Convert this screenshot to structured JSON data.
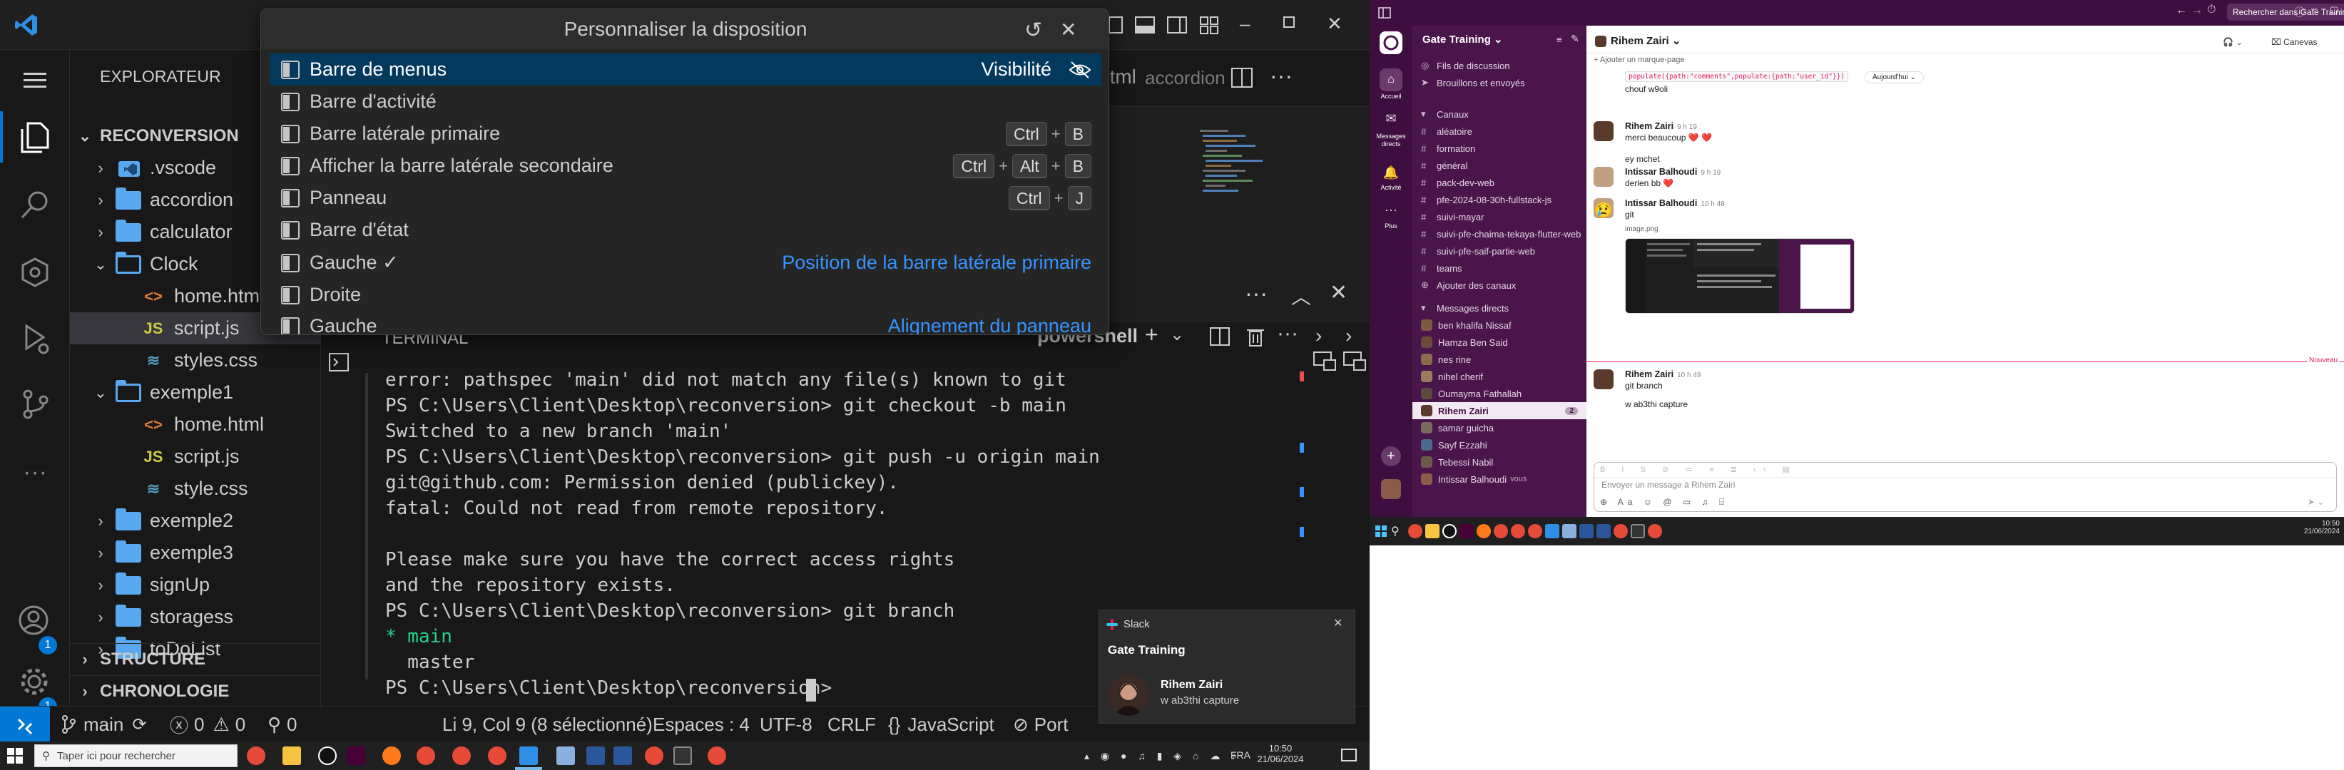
{
  "vscode": {
    "explorer_title": "EXPLORATEUR",
    "root": "RECONVERSION",
    "tree": [
      {
        "label": ".vscode",
        "kind": "vscode-folder",
        "depth": 1,
        "twisty": "›"
      },
      {
        "label": "accordion",
        "kind": "folder",
        "depth": 1,
        "twisty": "›"
      },
      {
        "label": "calculator",
        "kind": "folder",
        "depth": 1,
        "twisty": "›"
      },
      {
        "label": "Clock",
        "kind": "folder-open",
        "depth": 1,
        "twisty": "⌄"
      },
      {
        "label": "home.html",
        "kind": "html",
        "depth": 2,
        "twisty": ""
      },
      {
        "label": "script.js",
        "kind": "js",
        "depth": 2,
        "twisty": "",
        "selected": true
      },
      {
        "label": "styles.css",
        "kind": "css",
        "depth": 2,
        "twisty": ""
      },
      {
        "label": "exemple1",
        "kind": "folder-open",
        "depth": 1,
        "twisty": "⌄"
      },
      {
        "label": "home.html",
        "kind": "html",
        "depth": 2,
        "twisty": ""
      },
      {
        "label": "script.js",
        "kind": "js",
        "depth": 2,
        "twisty": ""
      },
      {
        "label": "style.css",
        "kind": "css",
        "depth": 2,
        "twisty": ""
      },
      {
        "label": "exemple2",
        "kind": "folder",
        "depth": 1,
        "twisty": "›"
      },
      {
        "label": "exemple3",
        "kind": "folder",
        "depth": 1,
        "twisty": "›"
      },
      {
        "label": "signUp",
        "kind": "folder",
        "depth": 1,
        "twisty": "›"
      },
      {
        "label": "storagess",
        "kind": "folder",
        "depth": 1,
        "twisty": "›"
      },
      {
        "label": "toDoList",
        "kind": "folder",
        "depth": 1,
        "twisty": "›"
      }
    ],
    "sections": [
      "STRUCTURE",
      "CHRONOLOGIE"
    ],
    "tab_peek": "html",
    "tab_peek2": "accordion",
    "quickpick": {
      "title": "Personnaliser la disposition",
      "rows": [
        {
          "label": "Barre de menus",
          "right": "Visibilité",
          "keys": []
        },
        {
          "label": "Barre d'activité",
          "keys": []
        },
        {
          "label": "Barre latérale primaire",
          "keys": [
            "Ctrl",
            "B"
          ]
        },
        {
          "label": "Afficher la barre latérale secondaire",
          "keys": [
            "Ctrl",
            "Alt",
            "B"
          ]
        },
        {
          "label": "Panneau",
          "keys": [
            "Ctrl",
            "J"
          ]
        },
        {
          "label": "Barre d'état",
          "keys": []
        },
        {
          "label": "Gauche ✓",
          "right": "Position de la barre latérale primaire",
          "keys": []
        },
        {
          "label": "Droite",
          "keys": []
        },
        {
          "label": "Gauche",
          "right": "Alignement du panneau",
          "keys": []
        }
      ]
    },
    "panel_tab": "TERMINAL",
    "shell": "powershell",
    "terminal": [
      {
        "t": "error: pathspec 'main' did not match any file(s) known to git"
      },
      {
        "t": "PS C:\\Users\\Client\\Desktop\\reconversion> git checkout -b main"
      },
      {
        "t": "Switched to a new branch 'main'"
      },
      {
        "t": "PS C:\\Users\\Client\\Desktop\\reconversion> git push -u origin main"
      },
      {
        "t": "git@github.com: Permission denied (publickey)."
      },
      {
        "t": "fatal: Could not read from remote repository."
      },
      {
        "t": ""
      },
      {
        "t": "Please make sure you have the correct access rights"
      },
      {
        "t": "and the repository exists."
      },
      {
        "t": "PS C:\\Users\\Client\\Desktop\\reconversion> git branch"
      },
      {
        "t": "* main",
        "green": true
      },
      {
        "t": "  master"
      },
      {
        "t": "PS C:\\Users\\Client\\Desktop\\reconversion> "
      }
    ],
    "status": {
      "branch": "main",
      "errors": "0",
      "warnings": "0",
      "ports": "0",
      "position": "Li 9, Col 9 (8 sélectionné)",
      "spaces": "Espaces : 4",
      "encoding": "UTF-8",
      "eol": "CRLF",
      "language": "JavaScript",
      "port_label": "Port"
    },
    "badge": "1",
    "notification": {
      "app": "Slack",
      "workspace": "Gate Training",
      "sender": "Rihem Zairi",
      "text": "w ab3thi capture"
    }
  },
  "taskbar_left": {
    "search_placeholder": "Taper ici pour rechercher",
    "lang": "FRA",
    "time": "10:50",
    "date": "21/06/2024"
  },
  "slack": {
    "search": "Rechercher dans Gate Training",
    "workspace": "Gate Training",
    "rail": [
      {
        "label": "Accueil"
      },
      {
        "label": "Messages directs"
      },
      {
        "label": "Activité"
      },
      {
        "label": "Plus"
      }
    ],
    "top_items": [
      "Fils de discussion",
      "Brouillons et envoyés"
    ],
    "channels_header": "Canaux",
    "channels": [
      "aléatoire",
      "formation",
      "général",
      "pack-dev-web",
      "pfe-2024-08-30h-fullstack-js",
      "suivi-mayar",
      "suivi-pfe-chaima-tekaya-flutter-web",
      "suivi-pfe-saif-partie-web",
      "teams"
    ],
    "add_channels": "Ajouter des canaux",
    "dm_header": "Messages directs",
    "dms": [
      {
        "name": "ben khalifa Nissaf"
      },
      {
        "name": "Hamza Ben Said"
      },
      {
        "name": "nes rine"
      },
      {
        "name": "nihel cherif"
      },
      {
        "name": "Oumayma Fathallah"
      },
      {
        "name": "Rihem Zairi",
        "active": true,
        "count": "2"
      },
      {
        "name": "samar guicha"
      },
      {
        "name": "Sayf Ezzahi"
      },
      {
        "name": "Tebessi Nabil"
      },
      {
        "name": "Intissar Balhoudi",
        "suffix": "vous"
      }
    ],
    "channel_name": "Rihem Zairi",
    "canvas": "Canevas",
    "bookmark": "Ajouter un marque-page",
    "code_snippet": "populate({path:\"comments\",populate:{path:\"user_id\"}})",
    "date_pill": "Aujourd'hui",
    "first_line": "chouf w9oli",
    "messages": [
      {
        "name": "Rihem Zairi",
        "time": "9 h 19",
        "lines": [
          "merci beaucoup ❤️ ❤️",
          "ey mchet"
        ]
      },
      {
        "name": "Intissar Balhoudi",
        "time": "9 h 19",
        "lines": [
          "derlen bb ❤️"
        ]
      },
      {
        "name": "Intissar Balhoudi",
        "time": "10 h 48",
        "lines": [
          "git"
        ],
        "image_label": "image.png"
      }
    ],
    "emoji_line": "😢",
    "new_label": "Nouveau",
    "last_msg": {
      "name": "Rihem Zairi",
      "time": "10 h 49",
      "lines": [
        "git branch",
        "w ab3thi capture"
      ]
    },
    "composer_placeholder": "Envoyer un message à Rihem Zairi",
    "composer_aa": "Aa"
  },
  "taskbar_right": {
    "time": "10:50",
    "date": "21/06/2024"
  },
  "colors": {
    "vscode_bg": "#1e1e1e",
    "accent": "#0078d4",
    "slack_purple": "#4a154b",
    "selection": "#04395e"
  }
}
